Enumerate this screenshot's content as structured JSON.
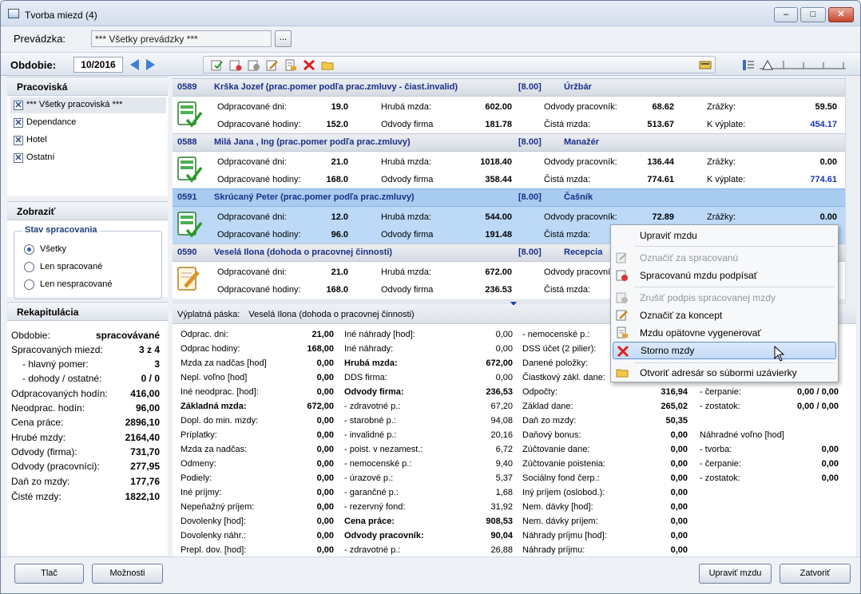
{
  "window": {
    "title": "Tvorba miezd  (4)"
  },
  "prevadzka": {
    "label": "Prevádzka:",
    "value": "*** Všetky prevádzky ***",
    "browse": "..."
  },
  "toolbar": {
    "period_label": "Obdobie:",
    "period": "10/2016"
  },
  "left": {
    "pracoviska_title": "Pracoviská",
    "pracoviska": [
      "*** Všetky pracoviská ***",
      "Dependance",
      "Hotel",
      "Ostatní"
    ],
    "zobrazit_title": "Zobraziť",
    "stav_title": "Stav spracovania",
    "stav_options": [
      "Všetky",
      "Len spracované",
      "Len nespracované"
    ],
    "rekap_title": "Rekapitulácia",
    "rekap": [
      {
        "k": "Obdobie:",
        "v": "spracovávané"
      },
      {
        "k": "Spracovaných miezd:",
        "v": "3 z 4"
      },
      {
        "k": "  - hlavný pomer:",
        "v": "3"
      },
      {
        "k": "  - dohody / ostatné:",
        "v": "0 / 0"
      },
      {
        "k": "Odpracovaných hodín:",
        "v": "416,00"
      },
      {
        "k": "Neodprac. hodín:",
        "v": "96,00"
      },
      {
        "k": "Cena práce:",
        "v": "2896,10"
      },
      {
        "k": "Hrubé mzdy:",
        "v": "2164,40"
      },
      {
        "k": "Odvody (firma):",
        "v": "731,70"
      },
      {
        "k": "Odvody (pracovníci):",
        "v": "277,95"
      },
      {
        "k": "Daň zo mzdy:",
        "v": "177,76"
      },
      {
        "k": "Čisté mzdy:",
        "v": "1822,10"
      }
    ]
  },
  "labels": {
    "odprac_dni": "Odpracované dni:",
    "odprac_hod": "Odpracované hodiny:",
    "hruba": "Hrubá mzda:",
    "odv_firma": "Odvody firma",
    "odv_prac": "Odvody pracovník:",
    "cista": "Čistá mzda:",
    "zrazky": "Zrážky:",
    "kvyplate": "K výplate:"
  },
  "employees": [
    {
      "id": "0589",
      "name": "Krška Jozef  (prac.pomer podľa prac.zmluvy - čiast.invalid)",
      "hours": "[8.00]",
      "pos": "Úržbár",
      "dni": "19.0",
      "hod": "152.0",
      "hruba": "602.00",
      "odvf": "181.78",
      "odvp": "68.62",
      "cista": "513.67",
      "zrazky": "59.50",
      "kvyp": "454.17",
      "icon": "check"
    },
    {
      "id": "0588",
      "name": "Milá Jana , Ing (prac.pomer podľa prac.zmluvy)",
      "hours": "[8.00]",
      "pos": "Manažér",
      "dni": "21.0",
      "hod": "168.0",
      "hruba": "1018.40",
      "odvf": "358.44",
      "odvp": "136.44",
      "cista": "774.61",
      "zrazky": "0.00",
      "kvyp": "774.61",
      "icon": "check"
    },
    {
      "id": "0591",
      "name": "Skrúcaný Peter  (prac.pomer podľa prac.zmluvy)",
      "hours": "[8.00]",
      "pos": "Čašník",
      "dni": "12.0",
      "hod": "96.0",
      "hruba": "544.00",
      "odvf": "191.48",
      "odvp": "72.89",
      "cista": "",
      "zrazky": "0.00",
      "kvyp": "",
      "icon": "check"
    },
    {
      "id": "0590",
      "name": "Veselá Ilona  (dohoda o pracovnej činnosti)",
      "hours": "[8.00]",
      "pos": "Recepcia",
      "dni": "21.0",
      "hod": "168.0",
      "hruba": "672.00",
      "odvf": "236.53",
      "odvp": "",
      "cista": "",
      "zrazky": "",
      "kvyp": "",
      "icon": "draft"
    }
  ],
  "payslip": {
    "label": "Výplatná páska:",
    "name": "Veselá Ilona  (dohoda o pracovnej činnosti)",
    "col1": [
      [
        "Odprac. dni:",
        "21,00"
      ],
      [
        "Odprac hodiny:",
        "168,00"
      ],
      [
        "Mzda za nadčas [hod]",
        "0,00"
      ],
      [
        "Nepl. voľno [hod]",
        "0,00"
      ],
      [
        "Iné neodprac. [hod]:",
        "0,00"
      ],
      [
        "Základná mzda:",
        "672,00"
      ],
      [
        "Dopl. do min. mzdy:",
        "0,00"
      ],
      [
        "Príplatky:",
        "0,00"
      ],
      [
        "Mzda za nadčas:",
        "0,00"
      ],
      [
        "Odmeny:",
        "0,00"
      ],
      [
        "Podiely:",
        "0,00"
      ],
      [
        "Iné príjmy:",
        "0,00"
      ],
      [
        "Nepeňažný príjem:",
        "0,00"
      ],
      [
        "Dovolenky [hod]:",
        "0,00"
      ],
      [
        "Dovolenky náhr.:",
        "0,00"
      ],
      [
        "Prepl. dov. [hod]:",
        "0,00"
      ]
    ],
    "col2": [
      [
        "Iné náhrady [hod]:",
        "0,00"
      ],
      [
        "Iné náhrady:",
        "0,00"
      ],
      [
        "Hrubá mzda:",
        "672,00"
      ],
      [
        "DDS firma:",
        "0,00"
      ],
      [
        "Odvody firma:",
        "236,53"
      ],
      [
        "  - zdravotné p.:",
        "67,20"
      ],
      [
        "  - starobné p.:",
        "94,08"
      ],
      [
        "  - invalidné p.:",
        "20,16"
      ],
      [
        "  - poist. v nezamest.:",
        "6,72"
      ],
      [
        "  - nemocenské p.:",
        "9,40"
      ],
      [
        "  - úrazové p.:",
        "5,37"
      ],
      [
        "  - garančné p.:",
        "1,68"
      ],
      [
        "  - rezervný fond:",
        "31,92"
      ],
      [
        "Cena práce:",
        "908,53"
      ],
      [
        "Odvody pracovník:",
        "90,04"
      ],
      [
        "  - zdravotné p.:",
        "26,88"
      ]
    ],
    "col3": [
      [
        "- nemocenské p.:",
        ""
      ],
      [
        "DSS účet (2 pilier):",
        ""
      ],
      [
        "Danené položky:",
        ""
      ],
      [
        "Čiastkový zákl. dane:",
        ""
      ],
      [
        "Odpočty:",
        "316,94"
      ],
      [
        "Základ dane:",
        "265,02"
      ],
      [
        "Daň zo mzdy:",
        "50,35"
      ],
      [
        "Daňový bonus:",
        "0,00"
      ],
      [
        "Zúčtovanie dane:",
        "0,00"
      ],
      [
        "Zúčtovanie poistenia:",
        "0,00"
      ],
      [
        "Sociálny fond čerp.:",
        "0,00"
      ],
      [
        "Iný príjem (oslobod.):",
        "0,00"
      ],
      [
        "Nem. dávky [hod]:",
        "0,00"
      ],
      [
        "Nem. dávky príjem:",
        "0,00"
      ],
      [
        "Náhrady príjmu [hod]:",
        "0,00"
      ],
      [
        "Náhrady príjmu:",
        "0,00"
      ]
    ],
    "col4": [
      [
        "Iné zrážky:",
        "0,00"
      ],
      [
        "Záloha:",
        "0,00"
      ],
      [
        "",
        ""
      ],
      [
        "Dovolenka [dni/hod]:",
        ""
      ],
      [
        "  - čerpanie:",
        "0,00 / 0,00"
      ],
      [
        "  - zostatok:",
        "0,00 / 0,00"
      ],
      [
        "",
        ""
      ],
      [
        "Náhradné voľno [hod]",
        ""
      ],
      [
        "  - tvorba:",
        "0,00"
      ],
      [
        "  - čerpanie:",
        "0,00"
      ],
      [
        "  - zostatok:",
        "0,00"
      ]
    ]
  },
  "context_menu": [
    {
      "label": "Upraviť mzdu",
      "state": "normal",
      "icon": "none"
    },
    {
      "sep": true
    },
    {
      "label": "Označiť za spracovanú",
      "state": "disabled",
      "icon": "edit-icon"
    },
    {
      "label": "Spracovanú mzdu podpísať",
      "state": "normal",
      "icon": "sign-icon"
    },
    {
      "sep": true
    },
    {
      "label": "Zrušiť podpis spracovanej mzdy",
      "state": "disabled",
      "icon": "unsign-icon"
    },
    {
      "label": "Označiť za koncept",
      "state": "normal",
      "icon": "draft-icon"
    },
    {
      "label": "Mzdu opätovne vygenerovať",
      "state": "normal",
      "icon": "regen-icon"
    },
    {
      "label": "Storno mzdy",
      "state": "highlight",
      "icon": "cancel-icon"
    },
    {
      "sep": true
    },
    {
      "label": "Otvoriť adresár so súbormi uzávierky",
      "state": "normal",
      "icon": "folder-icon"
    }
  ],
  "buttons": {
    "print": "Tlač",
    "options": "Možnosti",
    "edit": "Upraviť mzdu",
    "close": "Zatvoriť"
  },
  "colors": {
    "accent": "#1a33b8",
    "selected_row": "#bcd9f7"
  }
}
